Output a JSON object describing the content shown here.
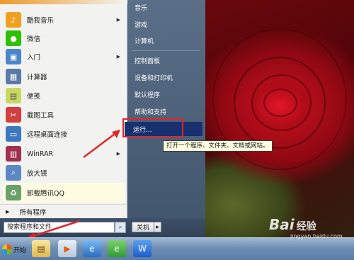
{
  "start_menu": {
    "programs": [
      {
        "label": "酷我音乐",
        "icon": "kuwo-music-icon",
        "color": "#f0a020",
        "has_arrow": true
      },
      {
        "label": "微信",
        "icon": "wechat-icon",
        "color": "#2dc100",
        "has_arrow": false
      },
      {
        "label": "入门",
        "icon": "getting-started-icon",
        "color": "#4a86c8",
        "has_arrow": true
      },
      {
        "label": "计算器",
        "icon": "calculator-icon",
        "color": "#5a7aa8",
        "has_arrow": false
      },
      {
        "label": "便笺",
        "icon": "sticky-notes-icon",
        "color": "#c8d860",
        "has_arrow": false
      },
      {
        "label": "截图工具",
        "icon": "snipping-tool-icon",
        "color": "#d04040",
        "has_arrow": false
      },
      {
        "label": "远程桌面连接",
        "icon": "remote-desktop-icon",
        "color": "#3c78c0",
        "has_arrow": false
      },
      {
        "label": "WinRAR",
        "icon": "winrar-icon",
        "color": "#a03050",
        "has_arrow": true
      },
      {
        "label": "放大镜",
        "icon": "magnifier-icon",
        "color": "#5d88c4",
        "has_arrow": false
      },
      {
        "label": "卸载腾讯QQ",
        "icon": "recycle-bin-icon",
        "color": "#6aa06a",
        "has_arrow": false
      }
    ],
    "all_programs": "所有程序",
    "right_items": {
      "music": "音乐",
      "games": "游戏",
      "computer": "计算机",
      "control_panel": "控制面板",
      "devices_printers": "设备和打印机",
      "default_programs": "默认程序",
      "help_support": "帮助和支持",
      "run": "运行..."
    },
    "search_placeholder": "搜索程序和文件",
    "shutdown_label": "关机"
  },
  "tooltip": "打开一个程序、文件夹、文档或网站。",
  "taskbar": {
    "start_label": "开始",
    "pinned": [
      "file-explorer-icon",
      "media-player-icon",
      "internet-explorer-icon",
      "browser-e-icon",
      "wps-icon"
    ]
  },
  "watermark": {
    "logo": "Bai",
    "logo_suffix": "经验",
    "url": "jingyan.baidu.com"
  },
  "colors": {
    "highlight": "#18306e",
    "annotation_red": "#e0262c",
    "menu_right_panel": "#4d627b"
  }
}
